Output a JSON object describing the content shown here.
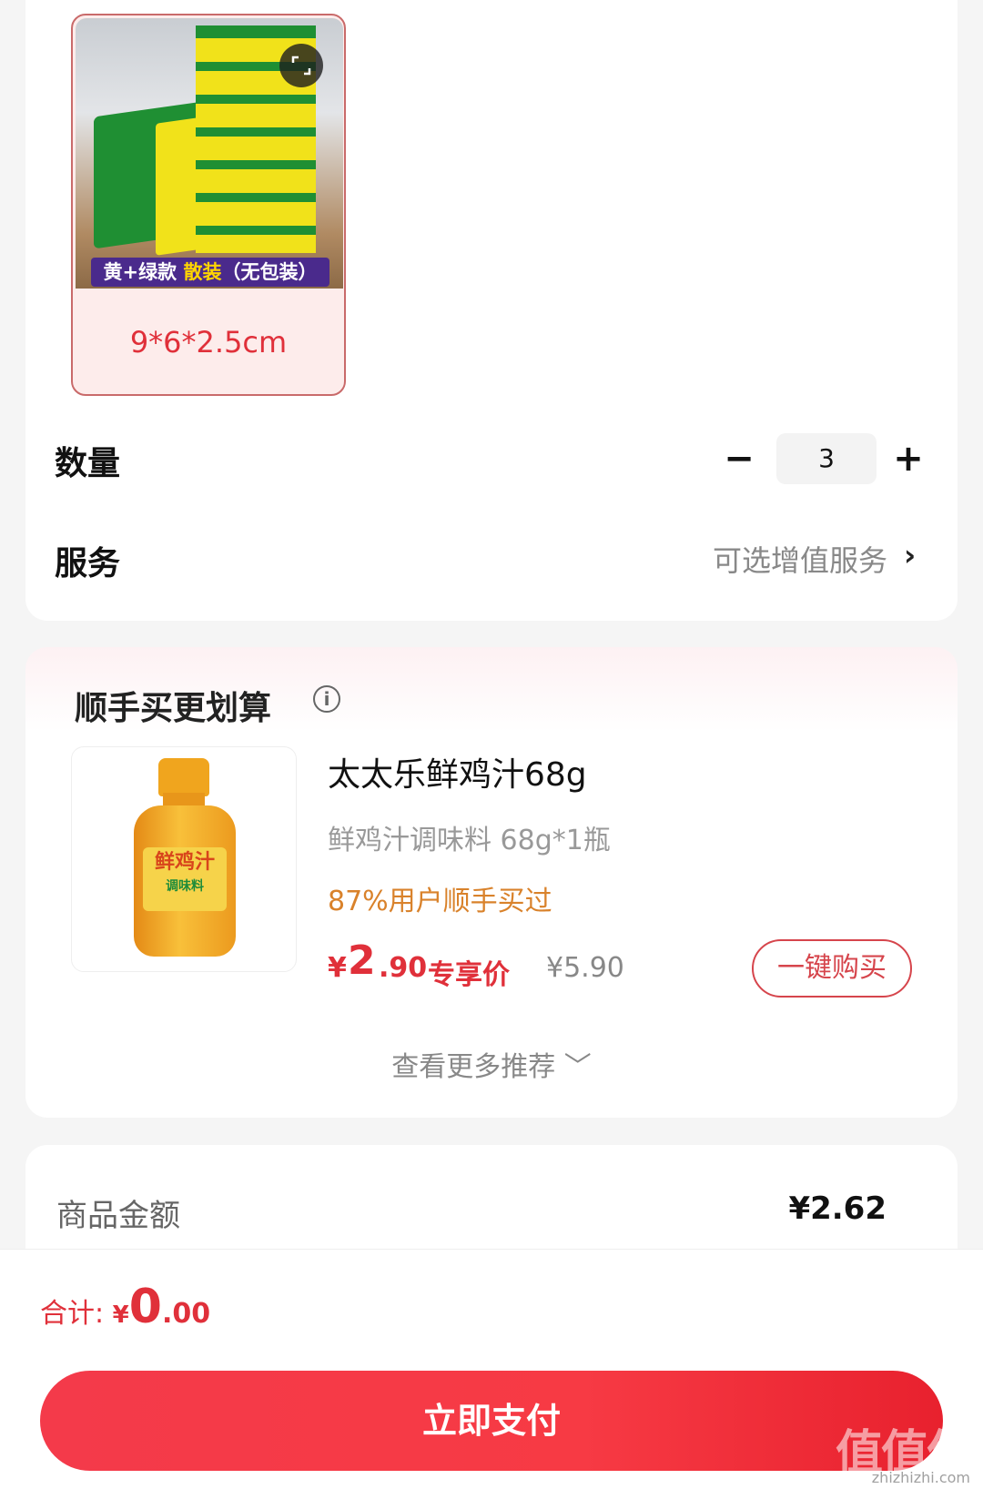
{
  "sku": {
    "caption_part1": "黄+绿款",
    "caption_part2": "散装",
    "caption_part3": "（无包装）",
    "size": "9*6*2.5cm",
    "colors": {
      "yellow": "#f1e21a",
      "green": "#1f8f33",
      "accent": "#e0303a"
    }
  },
  "quantity": {
    "label": "数量",
    "minus": "−",
    "value": "3",
    "plus": "+"
  },
  "service": {
    "label": "服务",
    "value": "可选增值服务",
    "chevron": "›"
  },
  "recommend": {
    "title": "顺手买更划算",
    "info_icon": "i",
    "product": {
      "thumb_label": "鲜鸡汁",
      "thumb_sub": "调味料",
      "name": "太太乐鲜鸡汁68g",
      "spec": "鲜鸡汁调味料 68g*1瓶",
      "bought": "87%用户顺手买过",
      "price_yen": "¥",
      "price_int": "2",
      "price_dec": ".90",
      "price_tag": "专享价",
      "original_price": "¥5.90",
      "buy_button": "一键购买"
    },
    "more": "查看更多推荐 ﹀"
  },
  "amounts": {
    "goods_label": "商品金额",
    "goods_value": "¥2.62"
  },
  "footer": {
    "total_label": "合计: ",
    "total_yen": "¥",
    "total_int": "0",
    "total_dec": ".00",
    "pay_button": "立即支付",
    "watermark": "值值值",
    "watermark_sub": "zhizhizhi.com"
  }
}
